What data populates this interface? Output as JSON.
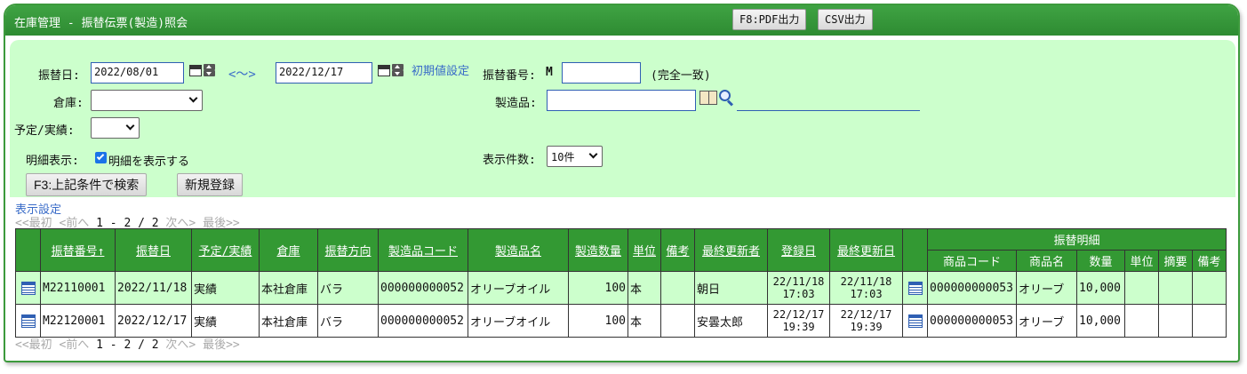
{
  "window": {
    "title": "在庫管理 - 振替伝票(製造)照会",
    "pdf_button": "F8:PDF出力",
    "csv_button": "CSV出力"
  },
  "form": {
    "date_label": "振替日:",
    "date_from": "2022/08/01",
    "range_sep": "<～>",
    "date_to": "2022/12/17",
    "reset_link": "初期値設定",
    "slip_no_label": "振替番号:",
    "slip_prefix": "M",
    "slip_no_value": "",
    "exact_match": "(完全一致)",
    "warehouse_label": "倉庫:",
    "warehouse_value": "",
    "product_label": "製造品:",
    "product_value": "",
    "plan_label": "予定/実績:",
    "plan_value": "",
    "detail_label": "明細表示:",
    "detail_checkbox_label": "明細を表示する",
    "detail_checked": true,
    "count_label": "表示件数:",
    "count_value": "10件",
    "search_button": "F3:上記条件で検索",
    "new_button": "新規登録"
  },
  "display_settings_link": "表示設定",
  "pager": {
    "first": "<<最初",
    "prev": "<前へ",
    "range": "1 - 2 / 2",
    "next": "次へ>",
    "last": "最後>>"
  },
  "table": {
    "headers": [
      "振替番号↑",
      "振替日",
      "予定/実績",
      "倉庫",
      "振替方向",
      "製造品コード",
      "製造品名",
      "製造数量",
      "単位",
      "備考",
      "最終更新者",
      "登録日",
      "最終更新日"
    ],
    "detail_group": "振替明細",
    "detail_headers": [
      "商品コード",
      "商品名",
      "数量",
      "単位",
      "摘要",
      "備考"
    ],
    "rows": [
      {
        "slip_no": "M22110001",
        "date": "2022/11/18",
        "plan": "実績",
        "warehouse": "本社倉庫",
        "direction": "バラ",
        "product_code": "000000000052",
        "product_name": "オリーブオイル",
        "qty": "100",
        "unit": "本",
        "note": "",
        "updater": "朝日",
        "reg_date": "22/11/18",
        "reg_time": "17:03",
        "upd_date": "22/11/18",
        "upd_time": "17:03",
        "d_code": "000000000053",
        "d_name": "オリーブ",
        "d_qty": "10,000",
        "d_unit": "",
        "d_summary": "",
        "d_note": ""
      },
      {
        "slip_no": "M22120001",
        "date": "2022/12/17",
        "plan": "実績",
        "warehouse": "本社倉庫",
        "direction": "バラ",
        "product_code": "000000000052",
        "product_name": "オリーブオイル",
        "qty": "100",
        "unit": "本",
        "note": "",
        "updater": "安曇太郎",
        "reg_date": "22/12/17",
        "reg_time": "19:39",
        "upd_date": "22/12/17",
        "upd_time": "19:39",
        "d_code": "000000000053",
        "d_name": "オリーブ",
        "d_qty": "10,000",
        "d_unit": "",
        "d_summary": "",
        "d_note": ""
      }
    ]
  },
  "colors": {
    "titlebar": "#339933",
    "panel": "#ccffcc",
    "header": "#339933",
    "link": "#3a6cc8"
  }
}
